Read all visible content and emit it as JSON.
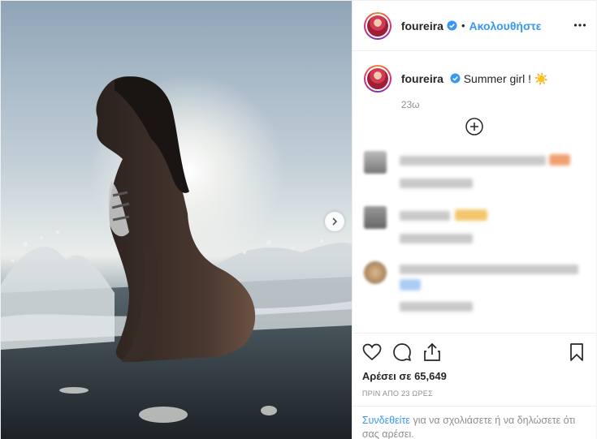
{
  "post": {
    "username": "foureira",
    "follow_label": "Ακολουθήστε",
    "dot": "•",
    "caption": "Summer girl ! ☀️",
    "caption_time": "23ω",
    "likes": "Αρέσει σε 65,649",
    "time_ago": "ΠΡΙΝ ΑΠΟ 23 ΩΡΕΣ",
    "login_link": "Συνδεθείτε",
    "login_text": " για να σχολιάσετε ή να δηλώσετε ότι σας αρέσει."
  },
  "colors": {
    "accent": "#3897f0",
    "text": "#262626",
    "muted": "#8e8e8e",
    "border": "#efefef"
  },
  "icons": [
    "verified-badge-icon",
    "more-options-icon",
    "load-more-plus-icon",
    "next-photo-arrow-icon",
    "heart-icon",
    "comment-icon",
    "share-icon",
    "bookmark-icon"
  ]
}
